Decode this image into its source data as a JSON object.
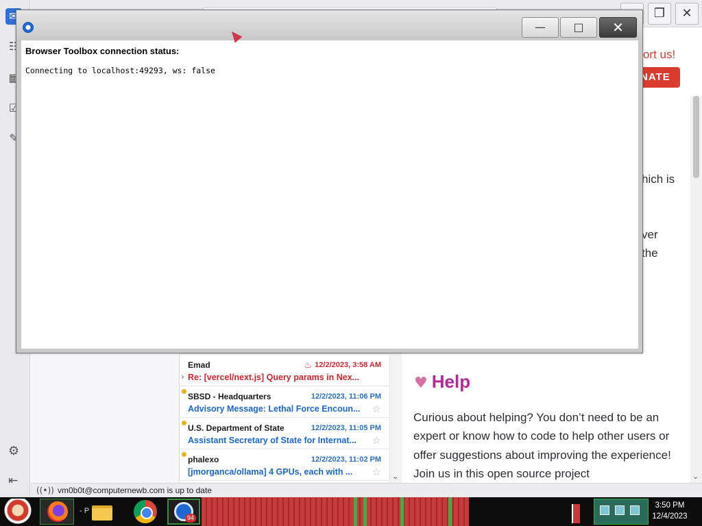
{
  "dialog": {
    "heading": "Browser Toolbox connection status:",
    "status": "Connecting to localhost:49293, ws: false",
    "minimize_glyph": "—",
    "maximize_glyph": "□",
    "close_glyph": "✕"
  },
  "mail": {
    "messages": [
      {
        "sender": "Emad",
        "date": "12/2/2023, 3:58 AM",
        "subject": "Re: [vercel/next.js] Query params in Nex..."
      },
      {
        "sender": "SBSD - Headquarters",
        "date": "12/2/2023, 11:06 PM",
        "subject": "Advisory Message: Lethal Force Encoun..."
      },
      {
        "sender": "U.S. Department of State",
        "date": "12/2/2023, 11:05 PM",
        "subject": "Assistant Secretary of State for Internat..."
      },
      {
        "sender": "phalexo",
        "date": "12/2/2023, 11:02 PM",
        "subject": "[jmorganca/ollama] 4 GPUs, each with ..."
      }
    ],
    "status_text": "vm0b0t@computernewb.com is up to date"
  },
  "web": {
    "support_text": "ort us!",
    "donate_label": "NATE",
    "fragments": [
      "hich is",
      "ver",
      "the"
    ],
    "help_heading": "Help",
    "help_body": "Curious about helping? You don’t need to be an expert or know how to code to help other users or offer suggestions about improving the experience! Join us in this open source project"
  },
  "taskbar": {
    "label_p": "- P",
    "badge": "94",
    "time": "3:50 PM",
    "date": "12/4/2023"
  },
  "colors": {
    "accent": "#2f6fd6",
    "hot": "#d0252e",
    "link": "#1c67c9",
    "help": "#b5299a",
    "donate": "#d93b2e"
  },
  "icons": [
    "mail-icon",
    "address-book-icon",
    "calendar-icon",
    "tasks-icon",
    "chat-icon",
    "gear-icon",
    "collapse-icon",
    "star-icon",
    "fire-icon",
    "heart-icon",
    "firefox-icon",
    "folder-icon",
    "chrome-icon",
    "thunderbird-icon"
  ]
}
